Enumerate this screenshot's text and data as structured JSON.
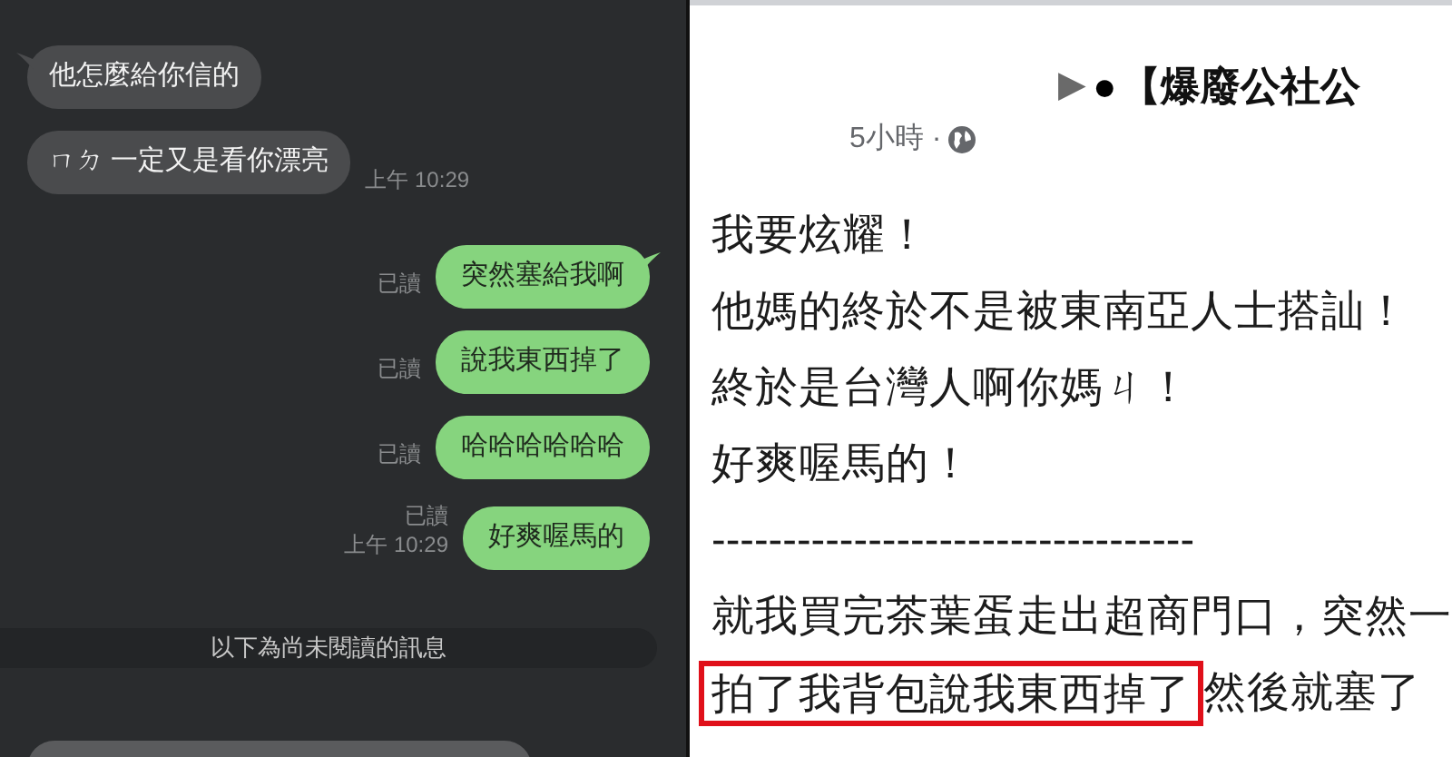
{
  "chat": {
    "messages": [
      {
        "kind": "incoming",
        "text": "他怎麼給你信的",
        "tail": true
      },
      {
        "kind": "incoming",
        "text": "ㄇㄉ 一定又是看你漂亮",
        "tail": false,
        "time": "上午 10:29"
      },
      {
        "kind": "outgoing",
        "text": "突然塞給我啊",
        "tail": true,
        "read": "已讀"
      },
      {
        "kind": "outgoing",
        "text": "說我東西掉了",
        "tail": false,
        "read": "已讀"
      },
      {
        "kind": "outgoing",
        "text": "哈哈哈哈哈哈",
        "tail": false,
        "read": "已讀"
      },
      {
        "kind": "outgoing",
        "text": "好爽喔馬的",
        "tail": false,
        "read": "已讀",
        "time": "上午 10:29"
      }
    ],
    "unread_divider": "以下為尚未閱讀的訊息"
  },
  "post": {
    "arrow": "▶",
    "dot": "●",
    "page_name": "【爆廢公社公",
    "time": "5小時 ·",
    "lines": [
      {
        "segments": [
          {
            "text": "我要炫耀！",
            "highlighted": false
          }
        ]
      },
      {
        "segments": [
          {
            "text": "他媽的終於不是被東南亞人士搭訕！",
            "highlighted": false
          }
        ]
      },
      {
        "segments": [
          {
            "text": "終於是台灣人啊你媽ㄐ！",
            "highlighted": false
          }
        ]
      },
      {
        "segments": [
          {
            "text": "好爽喔馬的！",
            "highlighted": false
          }
        ]
      },
      {
        "segments": [
          {
            "text": "----------------------------------",
            "highlighted": false
          }
        ]
      },
      {
        "segments": [
          {
            "text": "就我買完茶葉蛋走出超商門口，突然一",
            "highlighted": false
          }
        ]
      },
      {
        "segments": [
          {
            "text": "拍了我背包說我東西掉了",
            "highlighted": true
          },
          {
            "text": "然後就塞了",
            "highlighted": false
          }
        ]
      }
    ]
  }
}
